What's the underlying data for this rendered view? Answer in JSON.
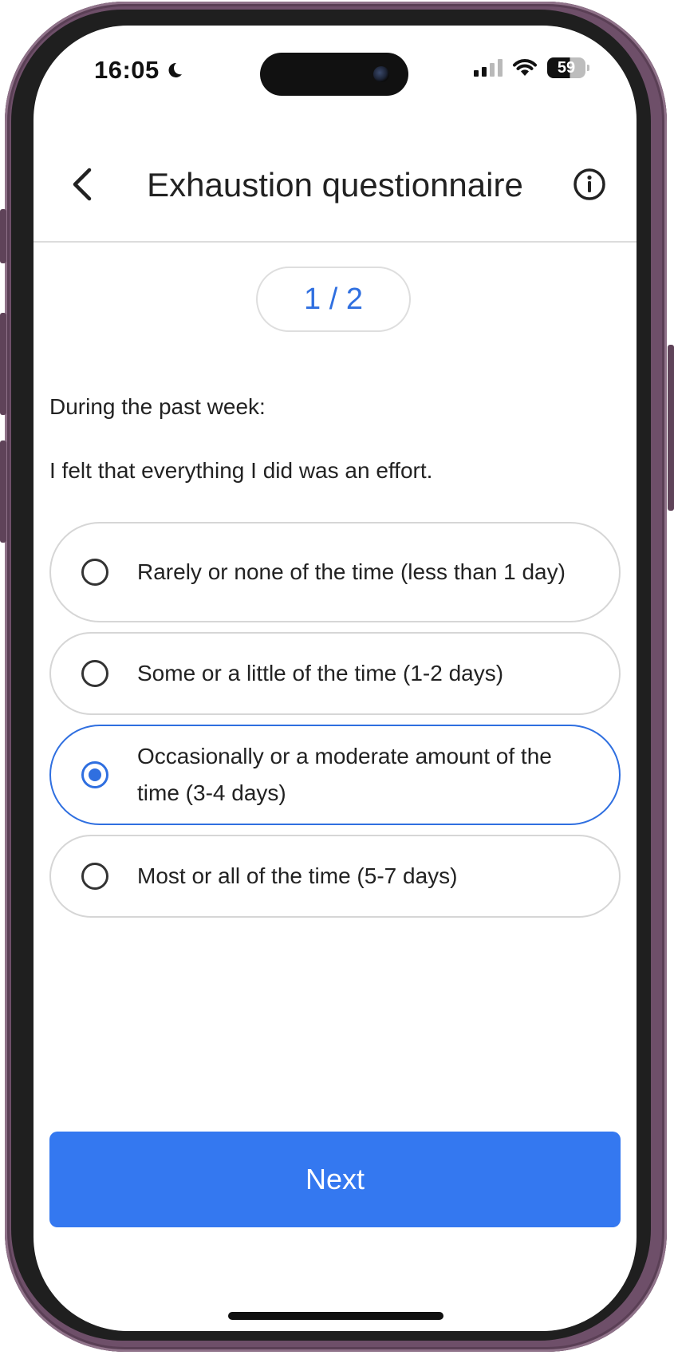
{
  "status_bar": {
    "time": "16:05",
    "moon_icon": "moon-icon",
    "battery_level": "59"
  },
  "header": {
    "title": "Exhaustion questionnaire",
    "back_icon": "chevron-left-icon",
    "info_icon": "info-circle-icon"
  },
  "progress": {
    "label": "1 / 2",
    "current": 1,
    "total": 2
  },
  "question": {
    "intro": "During the past week:",
    "text": "I felt that everything I did was an effort."
  },
  "options": [
    {
      "label": "Rarely or none of the time (less than 1 day)",
      "selected": false
    },
    {
      "label": "Some or a little of the time (1-2 days)",
      "selected": false
    },
    {
      "label": "Occasionally or a moderate amount of the time (3-4 days)",
      "selected": true
    },
    {
      "label": "Most or all of the time (5-7 days)",
      "selected": false
    }
  ],
  "next_button": {
    "label": "Next"
  },
  "colors": {
    "accent": "#3478f0",
    "frame": "#6e4f69"
  }
}
